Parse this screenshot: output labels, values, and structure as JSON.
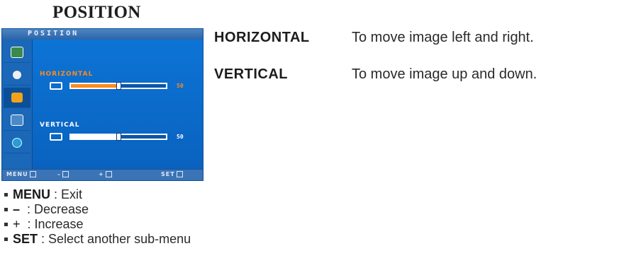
{
  "heading": "POSITION",
  "osd": {
    "title": "POSITION",
    "icons": [
      "picture-icon",
      "color-icon",
      "position-icon",
      "setup-icon",
      "select-icon"
    ],
    "active_icon_index": 2,
    "horizontal": {
      "label": "HORIZONTAL",
      "value": "50",
      "level": 0.5
    },
    "vertical": {
      "label": "VERTICAL",
      "value": "50",
      "level": 0.5
    },
    "footer": {
      "menu": "MENU",
      "minus": "–",
      "plus": "+",
      "set": "SET"
    },
    "colors": {
      "panel": "#0d6fd0",
      "accent": "#ff8a1a"
    }
  },
  "items": [
    {
      "term": "HORIZONTAL",
      "description": "To move image left and right."
    },
    {
      "term": "VERTICAL",
      "description": "To move image up and down."
    }
  ],
  "legend": [
    {
      "key": "MENU",
      "text": ": Exit"
    },
    {
      "key": "–",
      "text": ": Decrease"
    },
    {
      "key": "+",
      "text": ": Increase"
    },
    {
      "key": "SET",
      "text": ": Select another sub-menu"
    }
  ]
}
